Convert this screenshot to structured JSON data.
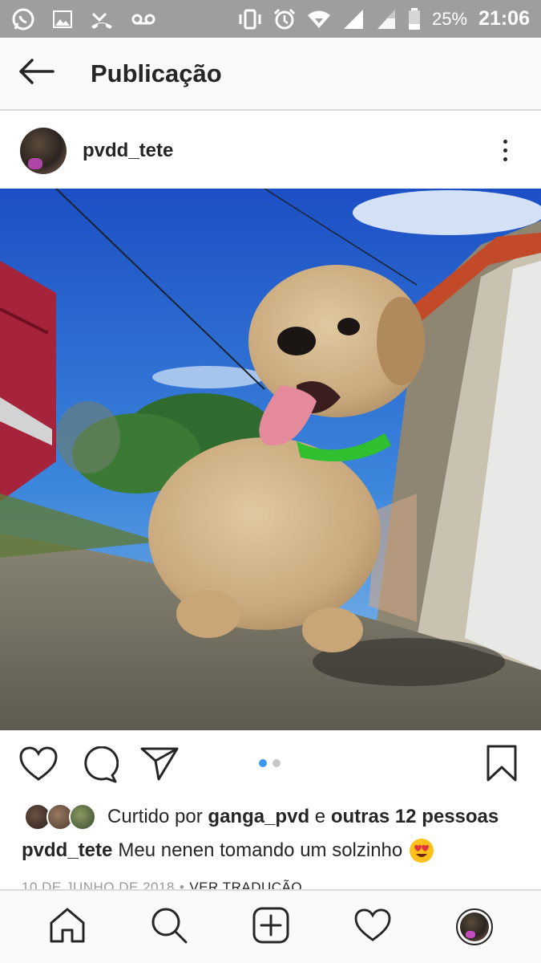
{
  "status_bar": {
    "battery": "25%",
    "time": "21:06",
    "icons": [
      "whatsapp-icon",
      "image-icon",
      "missed-call-icon",
      "voicemail-icon",
      "vibrate-icon",
      "alarm-icon",
      "wifi-icon",
      "signal-icon",
      "battery-icon"
    ]
  },
  "header": {
    "title": "Publicação",
    "back_icon": "arrow-left-icon"
  },
  "post": {
    "username": "pvdd_tete",
    "more_icon": "more-vertical-icon",
    "carousel": {
      "count": 2,
      "active": 1
    }
  },
  "actions": {
    "icons": [
      "heart-icon",
      "comment-icon",
      "share-icon",
      "bookmark-icon"
    ]
  },
  "likes": {
    "prefix": "Curtido por",
    "user": "ganga_pvd",
    "connector": "e",
    "others": "outras 12 pessoas"
  },
  "caption": {
    "username": "pvdd_tete",
    "text": "Meu nenen tomando um solzinho",
    "emoji": "heart-eyes-emoji"
  },
  "meta": {
    "date": "10 DE JUNHO DE 2018",
    "separator": "•",
    "translate": "VER TRADUÇÃO"
  },
  "bottom_nav": {
    "items": [
      "home-icon",
      "search-icon",
      "add-post-icon",
      "activity-heart-icon",
      "profile-avatar"
    ]
  },
  "colors": {
    "accent": "#3897f0",
    "status_bar": "#9e9e9e",
    "text": "#262626",
    "muted": "#999999"
  }
}
